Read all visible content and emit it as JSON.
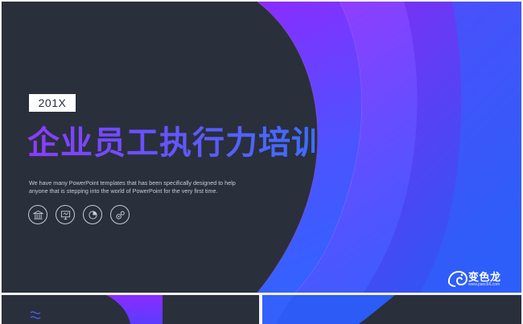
{
  "slide": {
    "year": "201X",
    "title": "企业员工执行力培训",
    "description_lines": [
      "We have many PowerPoint templates that has been specifically designed to help",
      "anyone that is stepping into the world of PowerPoint for the very first time."
    ],
    "icons": [
      "bank-icon",
      "presentation-icon",
      "chart-icon",
      "settings-icon"
    ]
  },
  "logo": {
    "name": "变色龙",
    "url": "www.panc66.com"
  },
  "colors": {
    "background": "#2a2f3c",
    "gradient_start": "#8a2cff",
    "gradient_end": "#2f64ff"
  }
}
